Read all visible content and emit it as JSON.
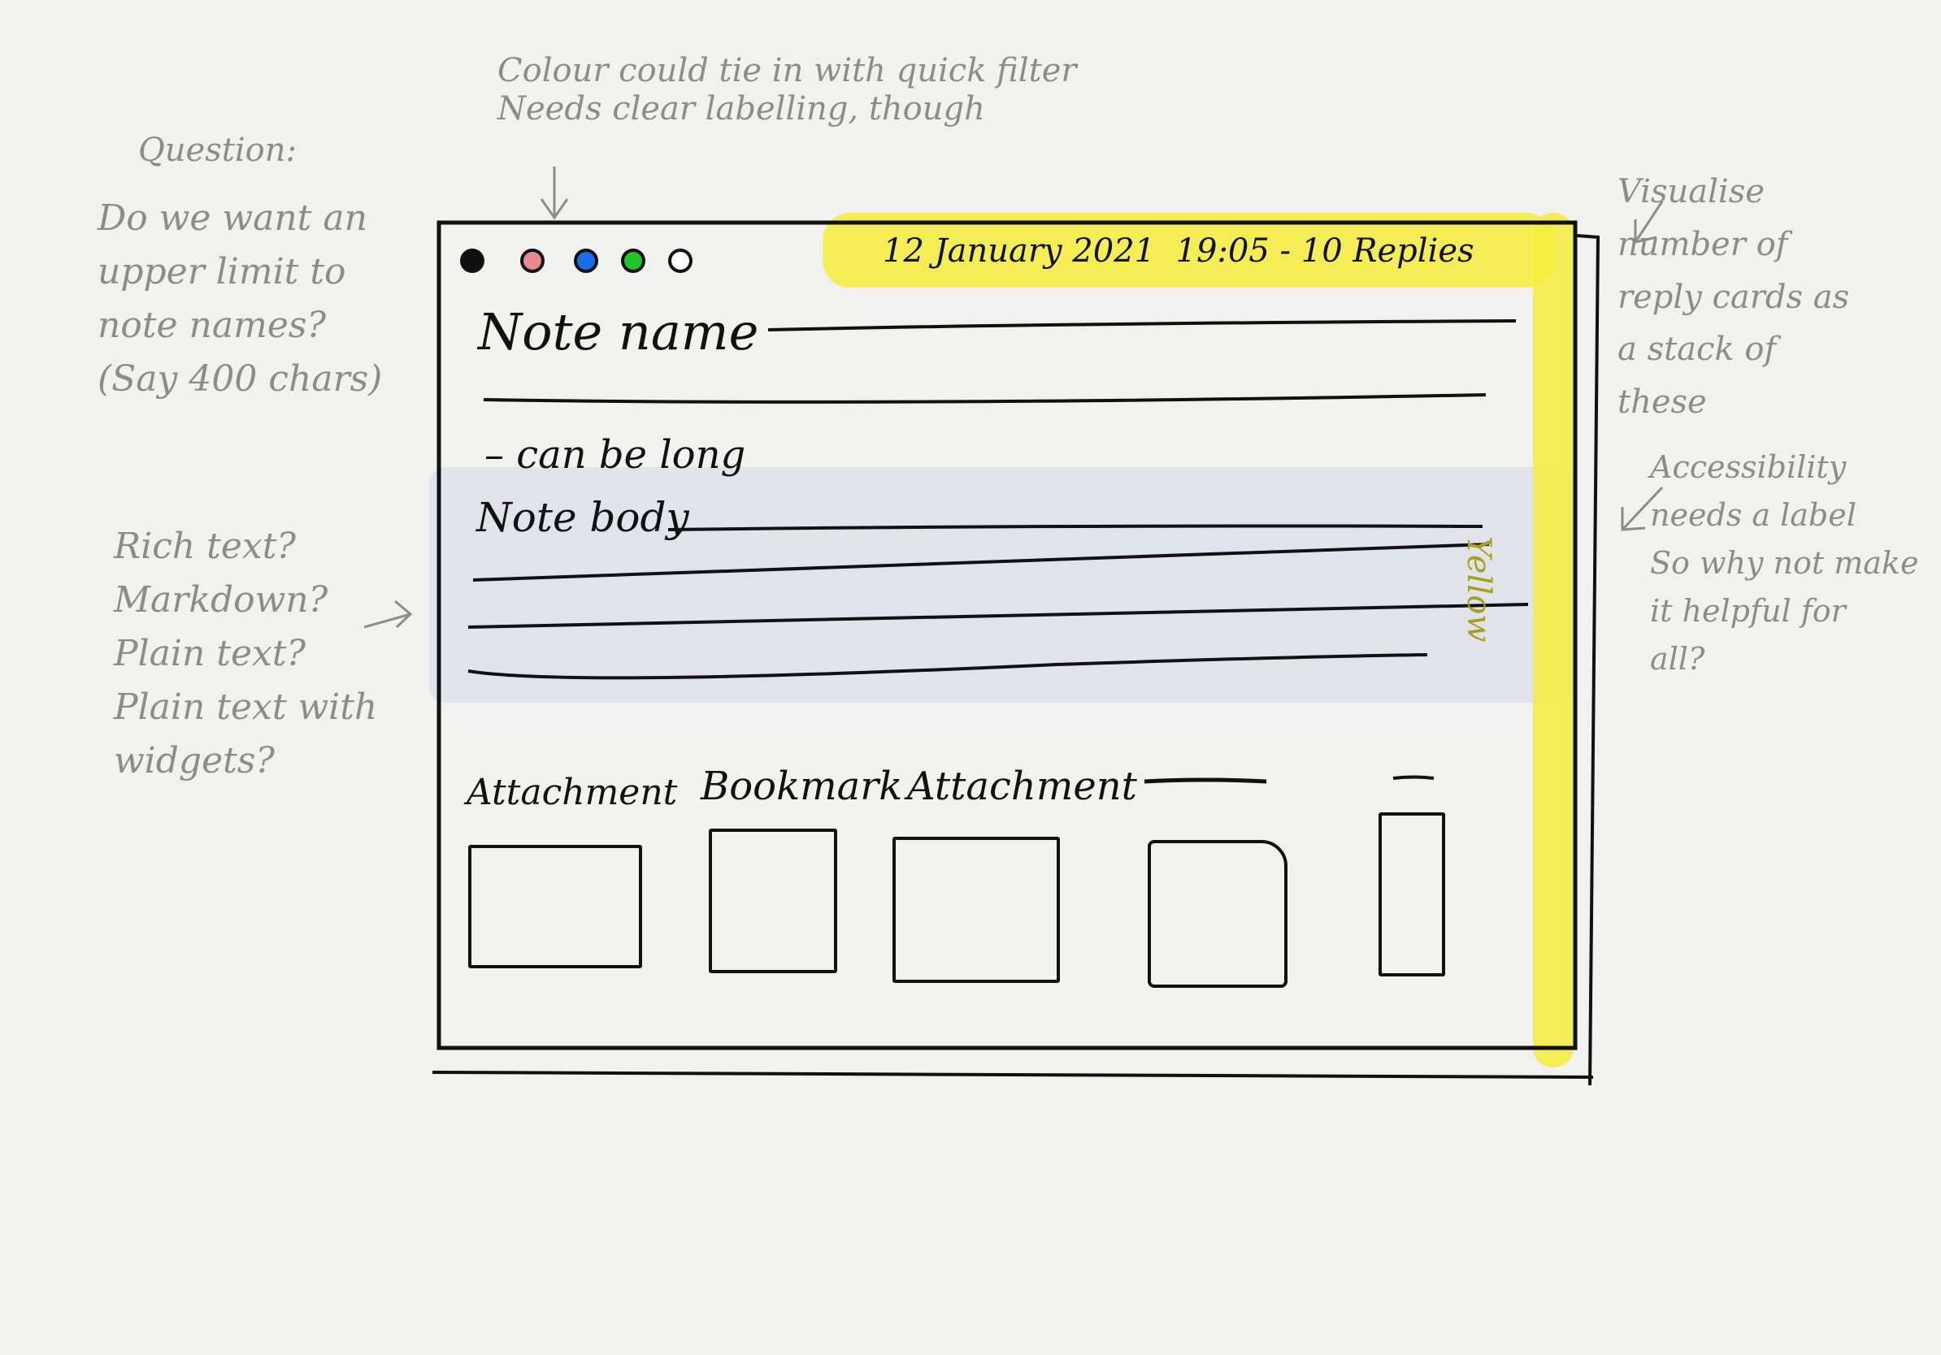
{
  "annotations": {
    "colour_note": "Colour could tie in with quick filter\nNeeds clear labelling, though",
    "question_title": "Question:",
    "question_body": "Do we want an\nupper limit to\nnote names?\n(Say 400 chars)",
    "formatting_note": "Rich text?\nMarkdown?\nPlain text?\nPlain text with\nwidgets?",
    "replies_note": "Visualise\nnumber of\nreply cards as\na stack of\nthese",
    "accessibility_note": "Accessibility\nneeds a label\nSo why not make\nit helpful for\nall?"
  },
  "card": {
    "header": "12 January 2021  19:05 - 10 Replies",
    "title_label": "Note name",
    "title_hint": "– can be long",
    "body_label": "Note body",
    "colour_label": "Yellow",
    "colour_swatches": [
      "#111111",
      "#e98b8e",
      "#1a6fe6",
      "#22c22a",
      "#ffffff"
    ],
    "attachments": [
      "Attachment",
      "Bookmark",
      "Attachment"
    ]
  },
  "colors": {
    "highlight": "#f4ec3b",
    "body_band": "#dfe1ea",
    "ink": "#111111",
    "pencil": "#8c8c8c"
  }
}
